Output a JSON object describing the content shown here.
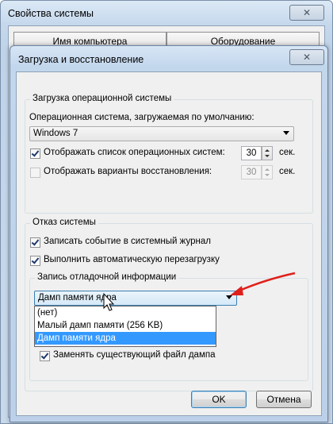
{
  "outer_window": {
    "title": "Свойства системы",
    "close_glyph": "✕",
    "tabs": [
      "Имя компьютера",
      "Оборудование"
    ]
  },
  "dialog": {
    "title": "Загрузка и восстановление",
    "close_glyph": "✕",
    "startup": {
      "group_label": "Загрузка операционной системы",
      "default_os_label": "Операционная система, загружаемая по умолчанию:",
      "default_os_value": "Windows 7",
      "show_os_list": {
        "label": "Отображать список операционных систем:",
        "checked": true,
        "value": "30",
        "unit": "сек."
      },
      "show_recovery": {
        "label": "Отображать варианты восстановления:",
        "checked": false,
        "value": "30",
        "unit": "сек."
      }
    },
    "failure": {
      "group_label": "Отказ системы",
      "write_event": {
        "label": "Записать событие в системный журнал",
        "checked": true
      },
      "auto_restart": {
        "label": "Выполнить автоматическую перезагрузку",
        "checked": true
      },
      "debug": {
        "group_label": "Запись отладочной информации",
        "selected": "Дамп памяти ядра",
        "options": [
          "(нет)",
          "Малый дамп памяти (256 KB)",
          "Дамп памяти ядра"
        ],
        "overwrite": {
          "label": "Заменять существующий файл дампа",
          "checked": true
        }
      }
    },
    "buttons": {
      "ok": "OK",
      "cancel": "Отмена"
    }
  },
  "annotation": {
    "arrow_color": "#e0201b"
  }
}
